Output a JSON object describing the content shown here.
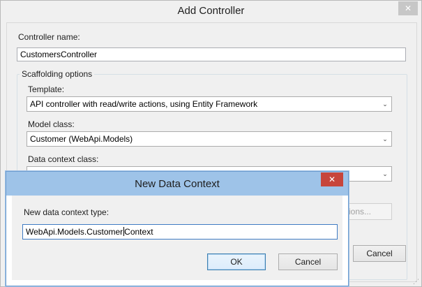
{
  "main_dialog": {
    "title": "Add Controller",
    "close_glyph": "✕",
    "controller_name_label": "Controller name:",
    "controller_name_value": "CustomersController",
    "scaffolding_group_label": "Scaffolding options",
    "template_label": "Template:",
    "template_value": "API controller with read/write actions, using Entity Framework",
    "model_class_label": "Model class:",
    "model_class_value": "Customer (WebApi.Models)",
    "data_context_label": "Data context class:",
    "data_context_value": "",
    "advanced_options_partial": "ions...",
    "cancel_label": "Cancel"
  },
  "new_context_dialog": {
    "title": "New Data Context",
    "close_glyph": "✕",
    "type_label": "New data context type:",
    "type_value_before_caret": "WebApi.Models.Customer",
    "type_value_after_caret": "Context",
    "ok_label": "OK",
    "cancel_label": "Cancel"
  },
  "icons": {
    "chevron": "⌄",
    "grip": "⋰"
  },
  "colors": {
    "child_titlebar": "#9ec3e8",
    "close_active": "#c7453b",
    "close_inactive": "#c7c7c7"
  }
}
